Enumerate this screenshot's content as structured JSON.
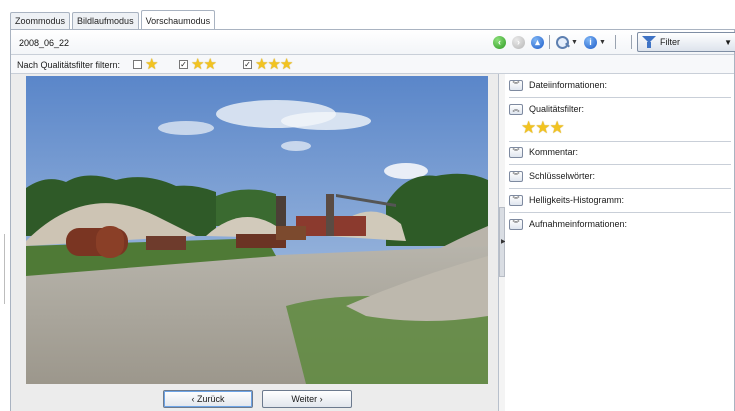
{
  "tabs": [
    {
      "label": "Zoommodus"
    },
    {
      "label": "Bildlaufmodus"
    },
    {
      "label": "Vorschaumodus",
      "active": true
    }
  ],
  "header": {
    "title": "2008_06_22",
    "filter_button": "Filter",
    "icons": [
      "back-arrow-icon",
      "forward-arrow-icon",
      "up-arrow-icon",
      "magnifier-icon",
      "info-icon",
      "filter-icon"
    ]
  },
  "quality_filter": {
    "label": "Nach Qualitätsfilter filtern:",
    "options": [
      {
        "stars": "★",
        "checked": false
      },
      {
        "stars": "★★",
        "checked": true
      },
      {
        "stars": "★★★",
        "checked": true
      }
    ]
  },
  "navigation": {
    "back_label": "‹ Zurück",
    "next_label": "Weiter ›"
  },
  "sidebar": {
    "sections": [
      {
        "label": "Dateiinformationen:",
        "expanded": false
      },
      {
        "label": "Qualitätsfilter:",
        "expanded": true,
        "stars": "★★★"
      },
      {
        "label": "Kommentar:",
        "expanded": false
      },
      {
        "label": "Schlüsselwörter:",
        "expanded": false
      },
      {
        "label": "Helligkeits-Histogramm:",
        "expanded": false
      },
      {
        "label": "Aufnahmeinformationen:",
        "expanded": false
      }
    ]
  },
  "colors": {
    "star": "#f2c320",
    "border": "#a9b3c1",
    "nav_green": "#2f9b24",
    "nav_blue": "#1d5cc9"
  }
}
